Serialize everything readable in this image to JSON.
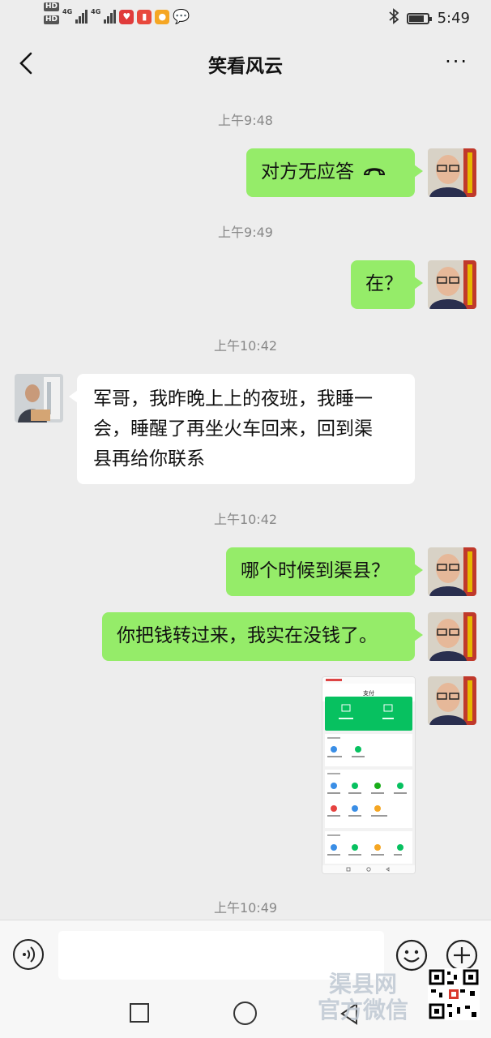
{
  "status_bar": {
    "hd1": "HD",
    "hd1_sub": "1",
    "hd2": "HD",
    "hd2_sub": "2",
    "net1": "4G",
    "net2": "4G",
    "time": "5:49",
    "battery_level": 0.8
  },
  "header": {
    "title": "笑看风云",
    "more": "···"
  },
  "messages": [
    {
      "type": "timestamp",
      "text": "上午9:48"
    },
    {
      "type": "outgoing",
      "text": "对方无应答",
      "icon": "phone-hangup-icon"
    },
    {
      "type": "timestamp",
      "text": "上午9:49"
    },
    {
      "type": "outgoing",
      "text": "在？"
    },
    {
      "type": "timestamp",
      "text": "上午10:42"
    },
    {
      "type": "incoming",
      "lines": [
        "军哥，我昨晚上上的夜班，我睡一",
        "会，睡醒了再坐火车回来，回到渠",
        "县再给你联系"
      ]
    },
    {
      "type": "timestamp",
      "text": "上午10:42"
    },
    {
      "type": "outgoing",
      "text": "哪个时候到渠县？"
    },
    {
      "type": "outgoing",
      "text": "你把钱转过来，我实在没钱了。"
    },
    {
      "type": "outgoing-image",
      "image": {
        "title": "支付"
      }
    },
    {
      "type": "timestamp",
      "text": "上午10:49"
    }
  ],
  "input_bar": {
    "voice_icon": "voice-icon",
    "emoji_icon": "emoji-icon",
    "plus_icon": "plus-icon",
    "value": ""
  },
  "watermark": {
    "line1": "渠县网",
    "line2": "官方微信"
  },
  "colors": {
    "background": "#ededed",
    "outgoing_bubble": "#95ec69",
    "incoming_bubble": "#ffffff",
    "wechat_green": "#07c160"
  }
}
